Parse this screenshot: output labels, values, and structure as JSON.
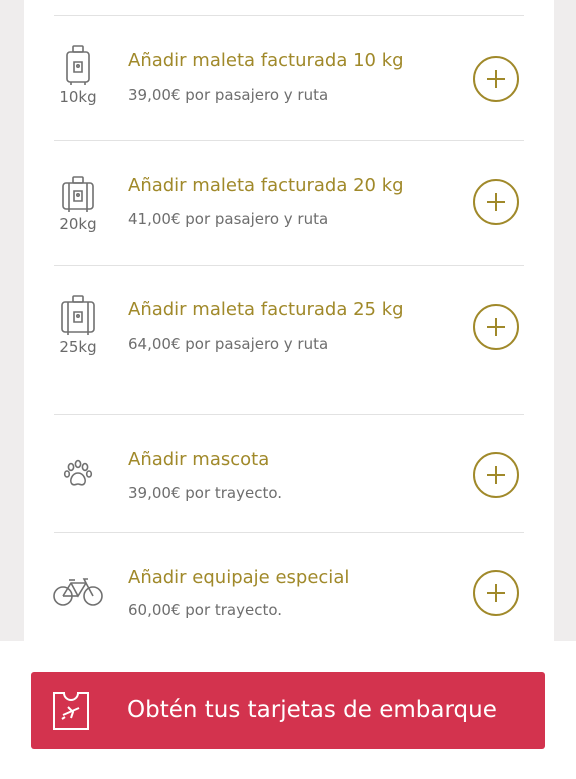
{
  "extras": [
    {
      "title": "Añadir maleta facturada 10 kg",
      "price": "39,00€ por pasajero y ruta",
      "icon": "luggage-10kg-icon",
      "weight": "10kg"
    },
    {
      "title": "Añadir maleta facturada 20 kg",
      "price": "41,00€ por pasajero y ruta",
      "icon": "luggage-20kg-icon",
      "weight": "20kg"
    },
    {
      "title": "Añadir maleta facturada 25 kg",
      "price": "64,00€ por pasajero y ruta",
      "icon": "luggage-25kg-icon",
      "weight": "25kg"
    },
    {
      "title": "Añadir mascota",
      "price": "39,00€ por trayecto.",
      "icon": "paw-icon"
    },
    {
      "title": "Añadir equipaje especial",
      "price": "60,00€ por trayecto.",
      "icon": "bicycle-icon"
    }
  ],
  "cta": {
    "label": "Obtén tus tarjetas de embarque",
    "icon": "boarding-pass-icon"
  },
  "colors": {
    "accent": "#a0892a",
    "cta": "#d3334e",
    "text_muted": "#6e6e6e"
  }
}
